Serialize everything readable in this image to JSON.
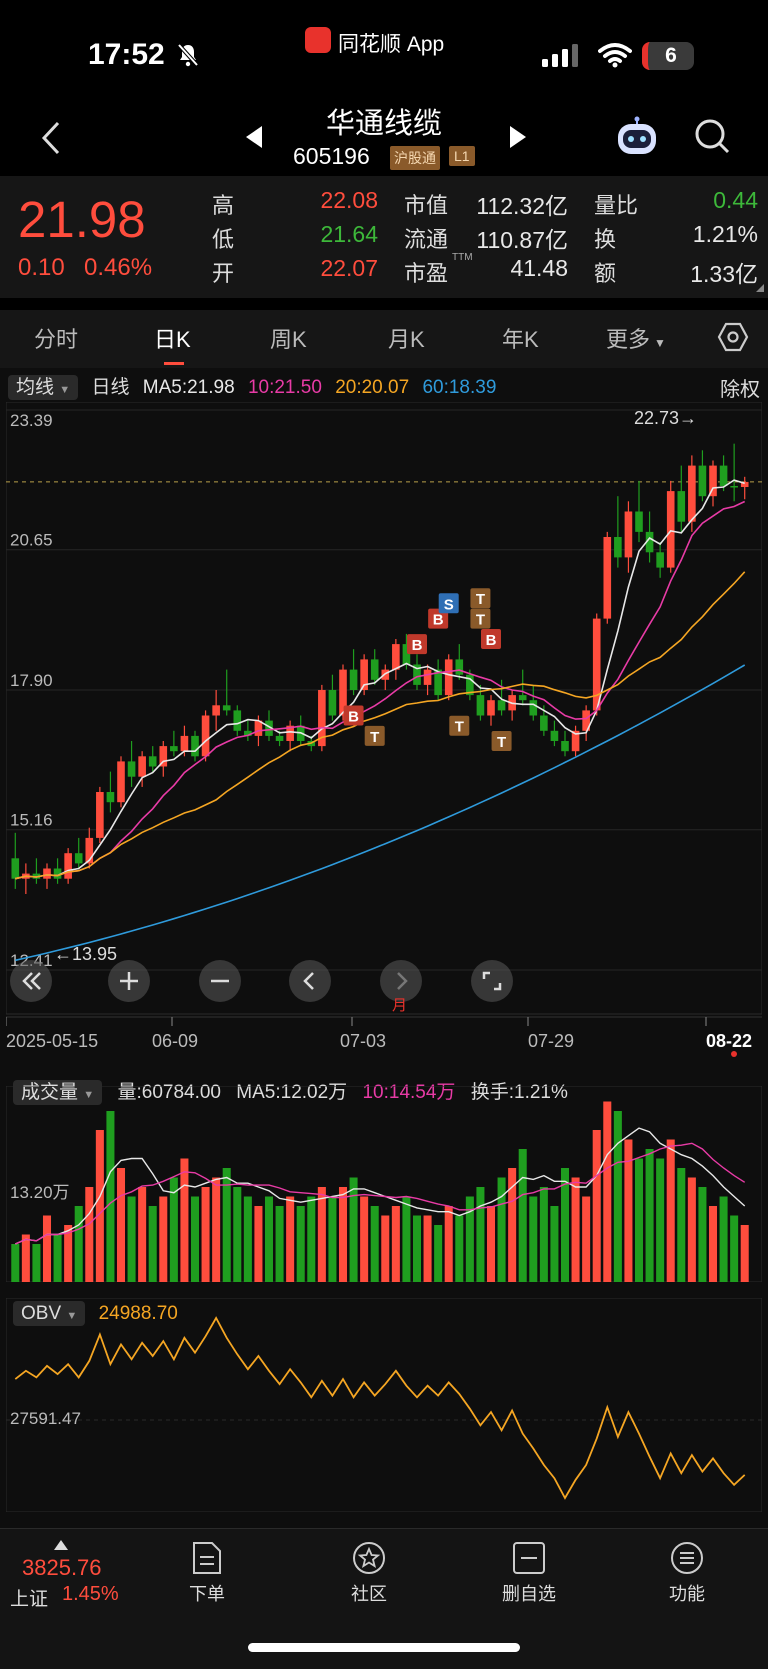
{
  "status_bar": {
    "time": "17:52",
    "battery": "6",
    "app_name": "同花顺 App"
  },
  "header": {
    "stock_name": "华通线缆",
    "stock_code": "605196",
    "tag_market": "沪股通",
    "tag_level": "L1"
  },
  "quote": {
    "price": "21.98",
    "change": "0.10",
    "change_pct": "0.46%",
    "high_label": "高",
    "high": "22.08",
    "low_label": "低",
    "low": "21.64",
    "open_label": "开",
    "open": "22.07",
    "mcap_label": "市值",
    "mcap": "112.32亿",
    "float_label": "流通",
    "float": "110.87亿",
    "pe_label": "市盈",
    "pe_sup": "TTM",
    "pe": "41.48",
    "vr_label": "量比",
    "vr": "0.44",
    "turnover_label": "换",
    "turnover": "1.21%",
    "amount_label": "额",
    "amount": "1.33亿"
  },
  "tabs": [
    "分时",
    "日K",
    "周K",
    "月K",
    "年K",
    "更多"
  ],
  "active_tab": "日K",
  "ma_legend": {
    "dropdown": "均线",
    "period": "日线",
    "ma5": "MA5:21.98",
    "ma10": "10:21.50",
    "ma20": "20:20.07",
    "ma60": "60:18.39",
    "rights": "除权"
  },
  "main_chart": {
    "y_ticks": [
      "23.39",
      "20.65",
      "17.90",
      "15.16",
      "12.41"
    ],
    "max_label": "22.73→",
    "min_label": "←13.95",
    "ylim": [
      12.41,
      23.39
    ]
  },
  "date_axis": [
    "2025-05-15",
    "06-09",
    "07-03",
    "07-29",
    "08-22"
  ],
  "month_marker": "月",
  "volume": {
    "dropdown": "成交量",
    "vol": "量:60784.00",
    "ma5": "MA5:12.02万",
    "ma10": "10:14.54万",
    "turnover": "换手:1.21%",
    "y_tick": "13.20万"
  },
  "obv": {
    "dropdown": "OBV",
    "value": "24988.70",
    "y_tick": "27591.47"
  },
  "bottom_bar": {
    "index_value": "3825.76",
    "index_name": "上证",
    "index_pct": "1.45%",
    "buttons": [
      "下单",
      "社区",
      "删自选",
      "功能"
    ]
  },
  "colors": {
    "up": "#ff4d3d",
    "down": "#1f9e1f",
    "ma5": "#e8e8e8",
    "ma10": "#e83ba6",
    "ma20": "#f5a623",
    "ma60": "#2f9bdc",
    "obv": "#f5a623"
  },
  "chart_data": [
    {
      "type": "candlestick",
      "title": "日K",
      "x_ticks": [
        "2025-05-15",
        "06-09",
        "07-03",
        "07-29",
        "08-22"
      ],
      "ylim": [
        12.41,
        23.39
      ],
      "series": [
        {
          "name": "MA5",
          "last": 21.98
        },
        {
          "name": "MA10",
          "last": 21.5
        },
        {
          "name": "MA20",
          "last": 20.07
        },
        {
          "name": "MA60",
          "last": 18.39
        }
      ],
      "max": 22.73,
      "min": 13.95,
      "ohlc": [
        [
          14.6,
          15.1,
          14.0,
          14.2
        ],
        [
          14.2,
          14.5,
          13.9,
          14.3
        ],
        [
          14.3,
          14.6,
          14.1,
          14.2
        ],
        [
          14.2,
          14.5,
          14.0,
          14.4
        ],
        [
          14.4,
          14.6,
          14.1,
          14.2
        ],
        [
          14.2,
          14.8,
          14.1,
          14.7
        ],
        [
          14.7,
          15.0,
          14.4,
          14.5
        ],
        [
          14.5,
          15.2,
          14.4,
          15.0
        ],
        [
          15.0,
          16.0,
          14.9,
          15.9
        ],
        [
          15.9,
          16.3,
          15.5,
          15.7
        ],
        [
          15.7,
          16.6,
          15.6,
          16.5
        ],
        [
          16.5,
          16.9,
          16.0,
          16.2
        ],
        [
          16.2,
          16.7,
          16.0,
          16.6
        ],
        [
          16.6,
          16.8,
          16.3,
          16.4
        ],
        [
          16.4,
          16.9,
          16.2,
          16.8
        ],
        [
          16.8,
          17.1,
          16.6,
          16.7
        ],
        [
          16.7,
          17.2,
          16.6,
          17.0
        ],
        [
          17.0,
          17.1,
          16.5,
          16.6
        ],
        [
          16.6,
          17.5,
          16.5,
          17.4
        ],
        [
          17.4,
          17.9,
          17.1,
          17.6
        ],
        [
          17.6,
          18.3,
          17.4,
          17.5
        ],
        [
          17.5,
          17.6,
          17.0,
          17.1
        ],
        [
          17.1,
          17.3,
          16.9,
          17.0
        ],
        [
          17.0,
          17.4,
          16.8,
          17.3
        ],
        [
          17.3,
          17.5,
          16.9,
          17.0
        ],
        [
          17.0,
          17.1,
          16.8,
          16.9
        ],
        [
          16.9,
          17.3,
          16.7,
          17.2
        ],
        [
          17.2,
          17.4,
          16.8,
          16.9
        ],
        [
          16.9,
          17.0,
          16.7,
          16.8
        ],
        [
          16.8,
          18.0,
          16.7,
          17.9
        ],
        [
          17.9,
          18.2,
          17.3,
          17.4
        ],
        [
          17.4,
          18.4,
          17.3,
          18.3
        ],
        [
          18.3,
          18.7,
          17.8,
          17.9
        ],
        [
          17.9,
          18.6,
          17.8,
          18.5
        ],
        [
          18.5,
          18.7,
          18.0,
          18.1
        ],
        [
          18.1,
          18.4,
          17.9,
          18.3
        ],
        [
          18.3,
          18.9,
          18.1,
          18.8
        ],
        [
          18.8,
          19.0,
          18.3,
          18.4
        ],
        [
          18.4,
          18.6,
          17.9,
          18.0
        ],
        [
          18.0,
          18.4,
          17.8,
          18.3
        ],
        [
          18.3,
          18.5,
          17.7,
          17.8
        ],
        [
          17.8,
          18.6,
          17.7,
          18.5
        ],
        [
          18.5,
          18.8,
          18.1,
          18.2
        ],
        [
          18.2,
          18.3,
          17.7,
          17.8
        ],
        [
          17.8,
          18.0,
          17.3,
          17.4
        ],
        [
          17.4,
          17.8,
          17.2,
          17.7
        ],
        [
          17.7,
          18.1,
          17.4,
          17.5
        ],
        [
          17.5,
          17.9,
          17.3,
          17.8
        ],
        [
          17.8,
          18.3,
          17.6,
          17.7
        ],
        [
          17.7,
          18.0,
          17.3,
          17.4
        ],
        [
          17.4,
          17.6,
          17.0,
          17.1
        ],
        [
          17.1,
          17.3,
          16.8,
          16.9
        ],
        [
          16.9,
          17.1,
          16.6,
          16.7
        ],
        [
          16.7,
          17.2,
          16.6,
          17.1
        ],
        [
          17.1,
          17.6,
          16.9,
          17.5
        ],
        [
          17.5,
          19.4,
          17.4,
          19.3
        ],
        [
          19.3,
          21.0,
          19.2,
          20.9
        ],
        [
          20.9,
          21.7,
          20.3,
          20.5
        ],
        [
          20.5,
          21.6,
          20.2,
          21.4
        ],
        [
          21.4,
          22.0,
          20.8,
          21.0
        ],
        [
          21.0,
          21.4,
          20.4,
          20.6
        ],
        [
          20.6,
          20.8,
          20.1,
          20.3
        ],
        [
          20.3,
          22.0,
          20.2,
          21.8
        ],
        [
          21.8,
          22.3,
          21.0,
          21.2
        ],
        [
          21.2,
          22.5,
          21.0,
          22.3
        ],
        [
          22.3,
          22.6,
          21.6,
          21.7
        ],
        [
          21.7,
          22.4,
          21.5,
          22.3
        ],
        [
          22.3,
          22.5,
          21.8,
          21.9
        ],
        [
          21.9,
          22.73,
          21.6,
          21.88
        ],
        [
          21.88,
          22.08,
          21.64,
          21.98
        ]
      ]
    },
    {
      "type": "bar",
      "title": "成交量",
      "y_tick": "13.20万",
      "series": [
        {
          "name": "MA5",
          "last": "12.02万"
        },
        {
          "name": "MA10",
          "last": "14.54万"
        }
      ],
      "values_wan": [
        4,
        5,
        4,
        7,
        5,
        6,
        8,
        10,
        16,
        18,
        12,
        9,
        10,
        8,
        9,
        11,
        13,
        9,
        10,
        11,
        12,
        10,
        9,
        8,
        9,
        8,
        9,
        8,
        9,
        10,
        9,
        10,
        11,
        9,
        8,
        7,
        8,
        9,
        7,
        7,
        6,
        8,
        7,
        9,
        10,
        8,
        11,
        12,
        14,
        9,
        10,
        8,
        12,
        11,
        9,
        16,
        19,
        18,
        15,
        13,
        14,
        13,
        15,
        12,
        11,
        10,
        8,
        9,
        7,
        6
      ]
    },
    {
      "type": "line",
      "title": "OBV",
      "y_tick": "27591.47",
      "last": 24988.7
    }
  ]
}
